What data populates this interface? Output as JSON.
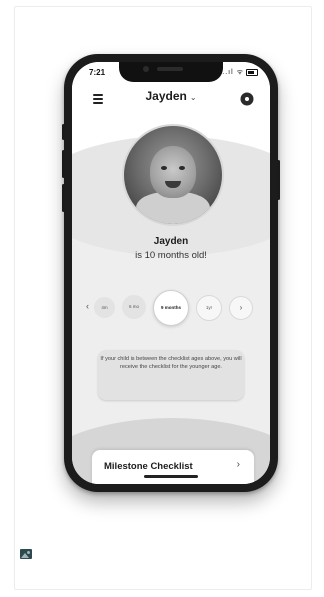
{
  "status_bar": {
    "time": "7:21",
    "icons": "..ıl ᯤ"
  },
  "header": {
    "title": "Jayden",
    "title_chevron": "⌄"
  },
  "profile": {
    "name": "Jayden",
    "age_text": "is 10 months old!"
  },
  "age_selector": {
    "prev_arrow": "‹",
    "next_arrow": "›",
    "options": [
      "4m",
      "6 mo",
      "9 months",
      "1yr"
    ],
    "selected": "9 months"
  },
  "info_card": {
    "text": "If your child is between the checklist ages above, you will receive the checklist for the younger age."
  },
  "milestone": {
    "label": "Milestone Checklist",
    "chevron": "›"
  },
  "colors": {
    "screen_bg": "#eeeeee",
    "phone_frame": "#1c1c1c",
    "card_bg": "#e2e2e2"
  },
  "icons": [
    "menu-icon",
    "gear-icon",
    "chevron-down-icon",
    "chevron-left-icon",
    "chevron-right-icon",
    "image-icon"
  ]
}
